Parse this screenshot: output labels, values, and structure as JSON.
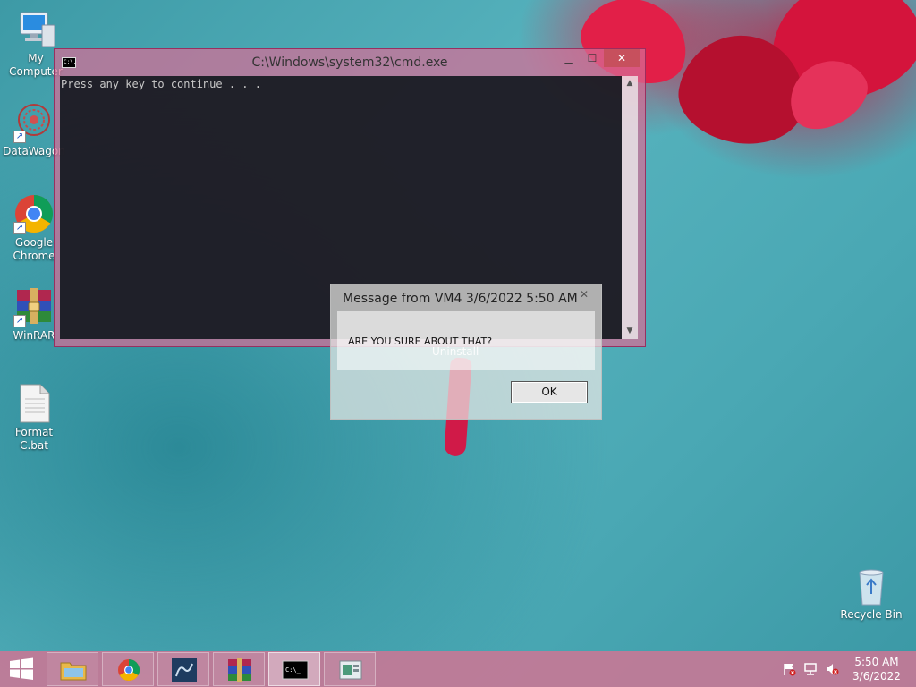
{
  "desktop": {
    "icons": [
      {
        "label": "My Computer"
      },
      {
        "label": "DataWagon"
      },
      {
        "label": "Google Chrome"
      },
      {
        "label": "WinRAR"
      },
      {
        "label": "Format C.bat"
      },
      {
        "label": "Recycle Bin"
      }
    ]
  },
  "cmd_window": {
    "title": "C:\\Windows\\system32\\cmd.exe",
    "icon_text": "C:\\.",
    "output": "Press any key to continue . . .",
    "minimize_glyph": "▁",
    "maximize_glyph": "☐",
    "close_glyph": "✕",
    "scroll_up_glyph": "▲",
    "scroll_down_glyph": "▼"
  },
  "message_dialog": {
    "title": "Message from VM4 3/6/2022 5:50 AM",
    "close_glyph": "✕",
    "message": "ARE YOU SURE ABOUT THAT?",
    "ghost_text": "Uninstall",
    "ok_label": "OK"
  },
  "taskbar": {
    "items": [
      "file-explorer",
      "google-chrome",
      "datawagon",
      "winrar",
      "command-prompt",
      "control-panel"
    ],
    "active_item": "command-prompt",
    "cmd_icon_text": "C:\\_",
    "clock_time": "5:50 AM",
    "clock_date": "3/6/2022"
  },
  "colors": {
    "taskbar": "#c87896",
    "cmd_frame": "#d66e96",
    "close_button": "#c7505d"
  }
}
